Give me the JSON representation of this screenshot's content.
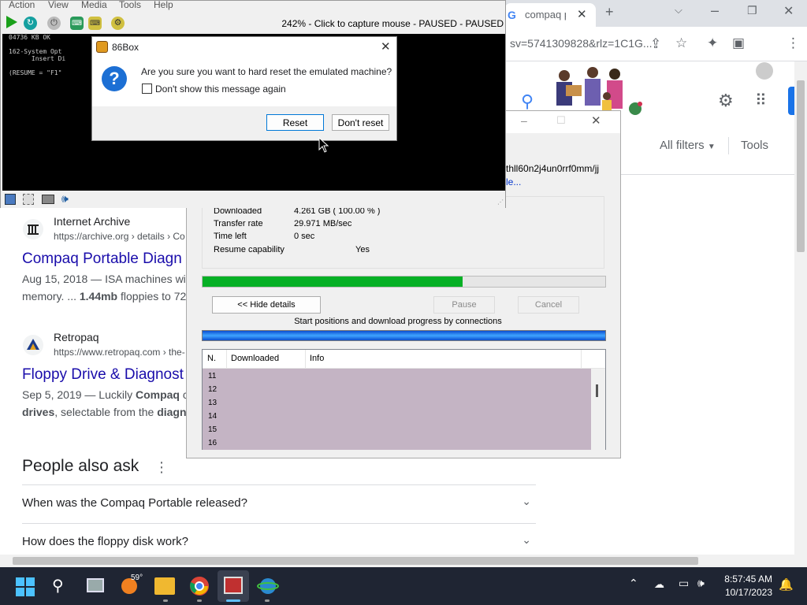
{
  "browser": {
    "tab_title": "compaq p",
    "url": "sv=5741309828&rlz=1C1G...",
    "filters_label": "All filters",
    "tools_label": "Tools"
  },
  "results": [
    {
      "site": "Internet Archive",
      "url": "https://archive.org › details › Co",
      "title": "Compaq Portable Diagn",
      "snippet_date": "Aug 15, 2018 — ISA machines with",
      "snippet_line2_pre": "memory. ... ",
      "snippet_bold": "1.44mb",
      "snippet_line2_post": " floppies to 72"
    },
    {
      "site": "Retropaq",
      "url": "https://www.retropaq.com › the-",
      "title": "Floppy Drive & Diagnost",
      "snippet_date": "Sep 5, 2019 — Luckily ",
      "snippet_bold": "Compaq",
      "snippet_line1_post": " co",
      "snippet_line2_bold": "drives",
      "snippet_line2_post": ", selectable from the ",
      "snippet_line2_bold2": "diagno"
    }
  ],
  "people_also_ask": {
    "title": "People also ask",
    "questions": [
      "When was the Compaq Portable released?",
      "How does the floppy disk work?"
    ]
  },
  "idm": {
    "link_line1": "thll60n2j4un0rrf0mm/jj",
    "link_line2": "le...",
    "downloaded_label": "Downloaded",
    "downloaded_value": "4.261  GB  ( 100.00 % )",
    "rate_label": "Transfer rate",
    "rate_value": "29.971  MB/sec",
    "time_label": "Time left",
    "time_value": "0 sec",
    "resume_label": "Resume capability",
    "resume_value": "Yes",
    "progress_fraction": 0.645,
    "hide_details_label": "<< Hide details",
    "pause_label": "Pause",
    "cancel_label": "Cancel",
    "connections_caption": "Start positions and download progress by connections",
    "grid_headers": [
      "N.",
      "Downloaded",
      "Info"
    ],
    "grid_rows": [
      "11",
      "12",
      "13",
      "14",
      "15",
      "16"
    ]
  },
  "emulator": {
    "menu": [
      "Action",
      "View",
      "Media",
      "Tools",
      "Help"
    ],
    "status": "242% - Click to capture mouse - PAUSED - PAUSED",
    "screen_lines": [
      "04736 KB OK",
      "",
      "162-System Opt",
      "      Insert Di",
      "",
      "(RESUME = \"F1\""
    ]
  },
  "dialog": {
    "title": "86Box",
    "question": "Are you sure you want to hard reset the emulated machine?",
    "checkbox_label": "Don't show this message again",
    "reset_label": "Reset",
    "dont_reset_label": "Don't reset"
  },
  "taskbar": {
    "weather": "59°",
    "time": "8:57:45 AM",
    "date": "10/17/2023"
  },
  "colors": {
    "link": "#1a0dab",
    "idm_progress": "#06b025",
    "taskbar": "#1f2533"
  }
}
